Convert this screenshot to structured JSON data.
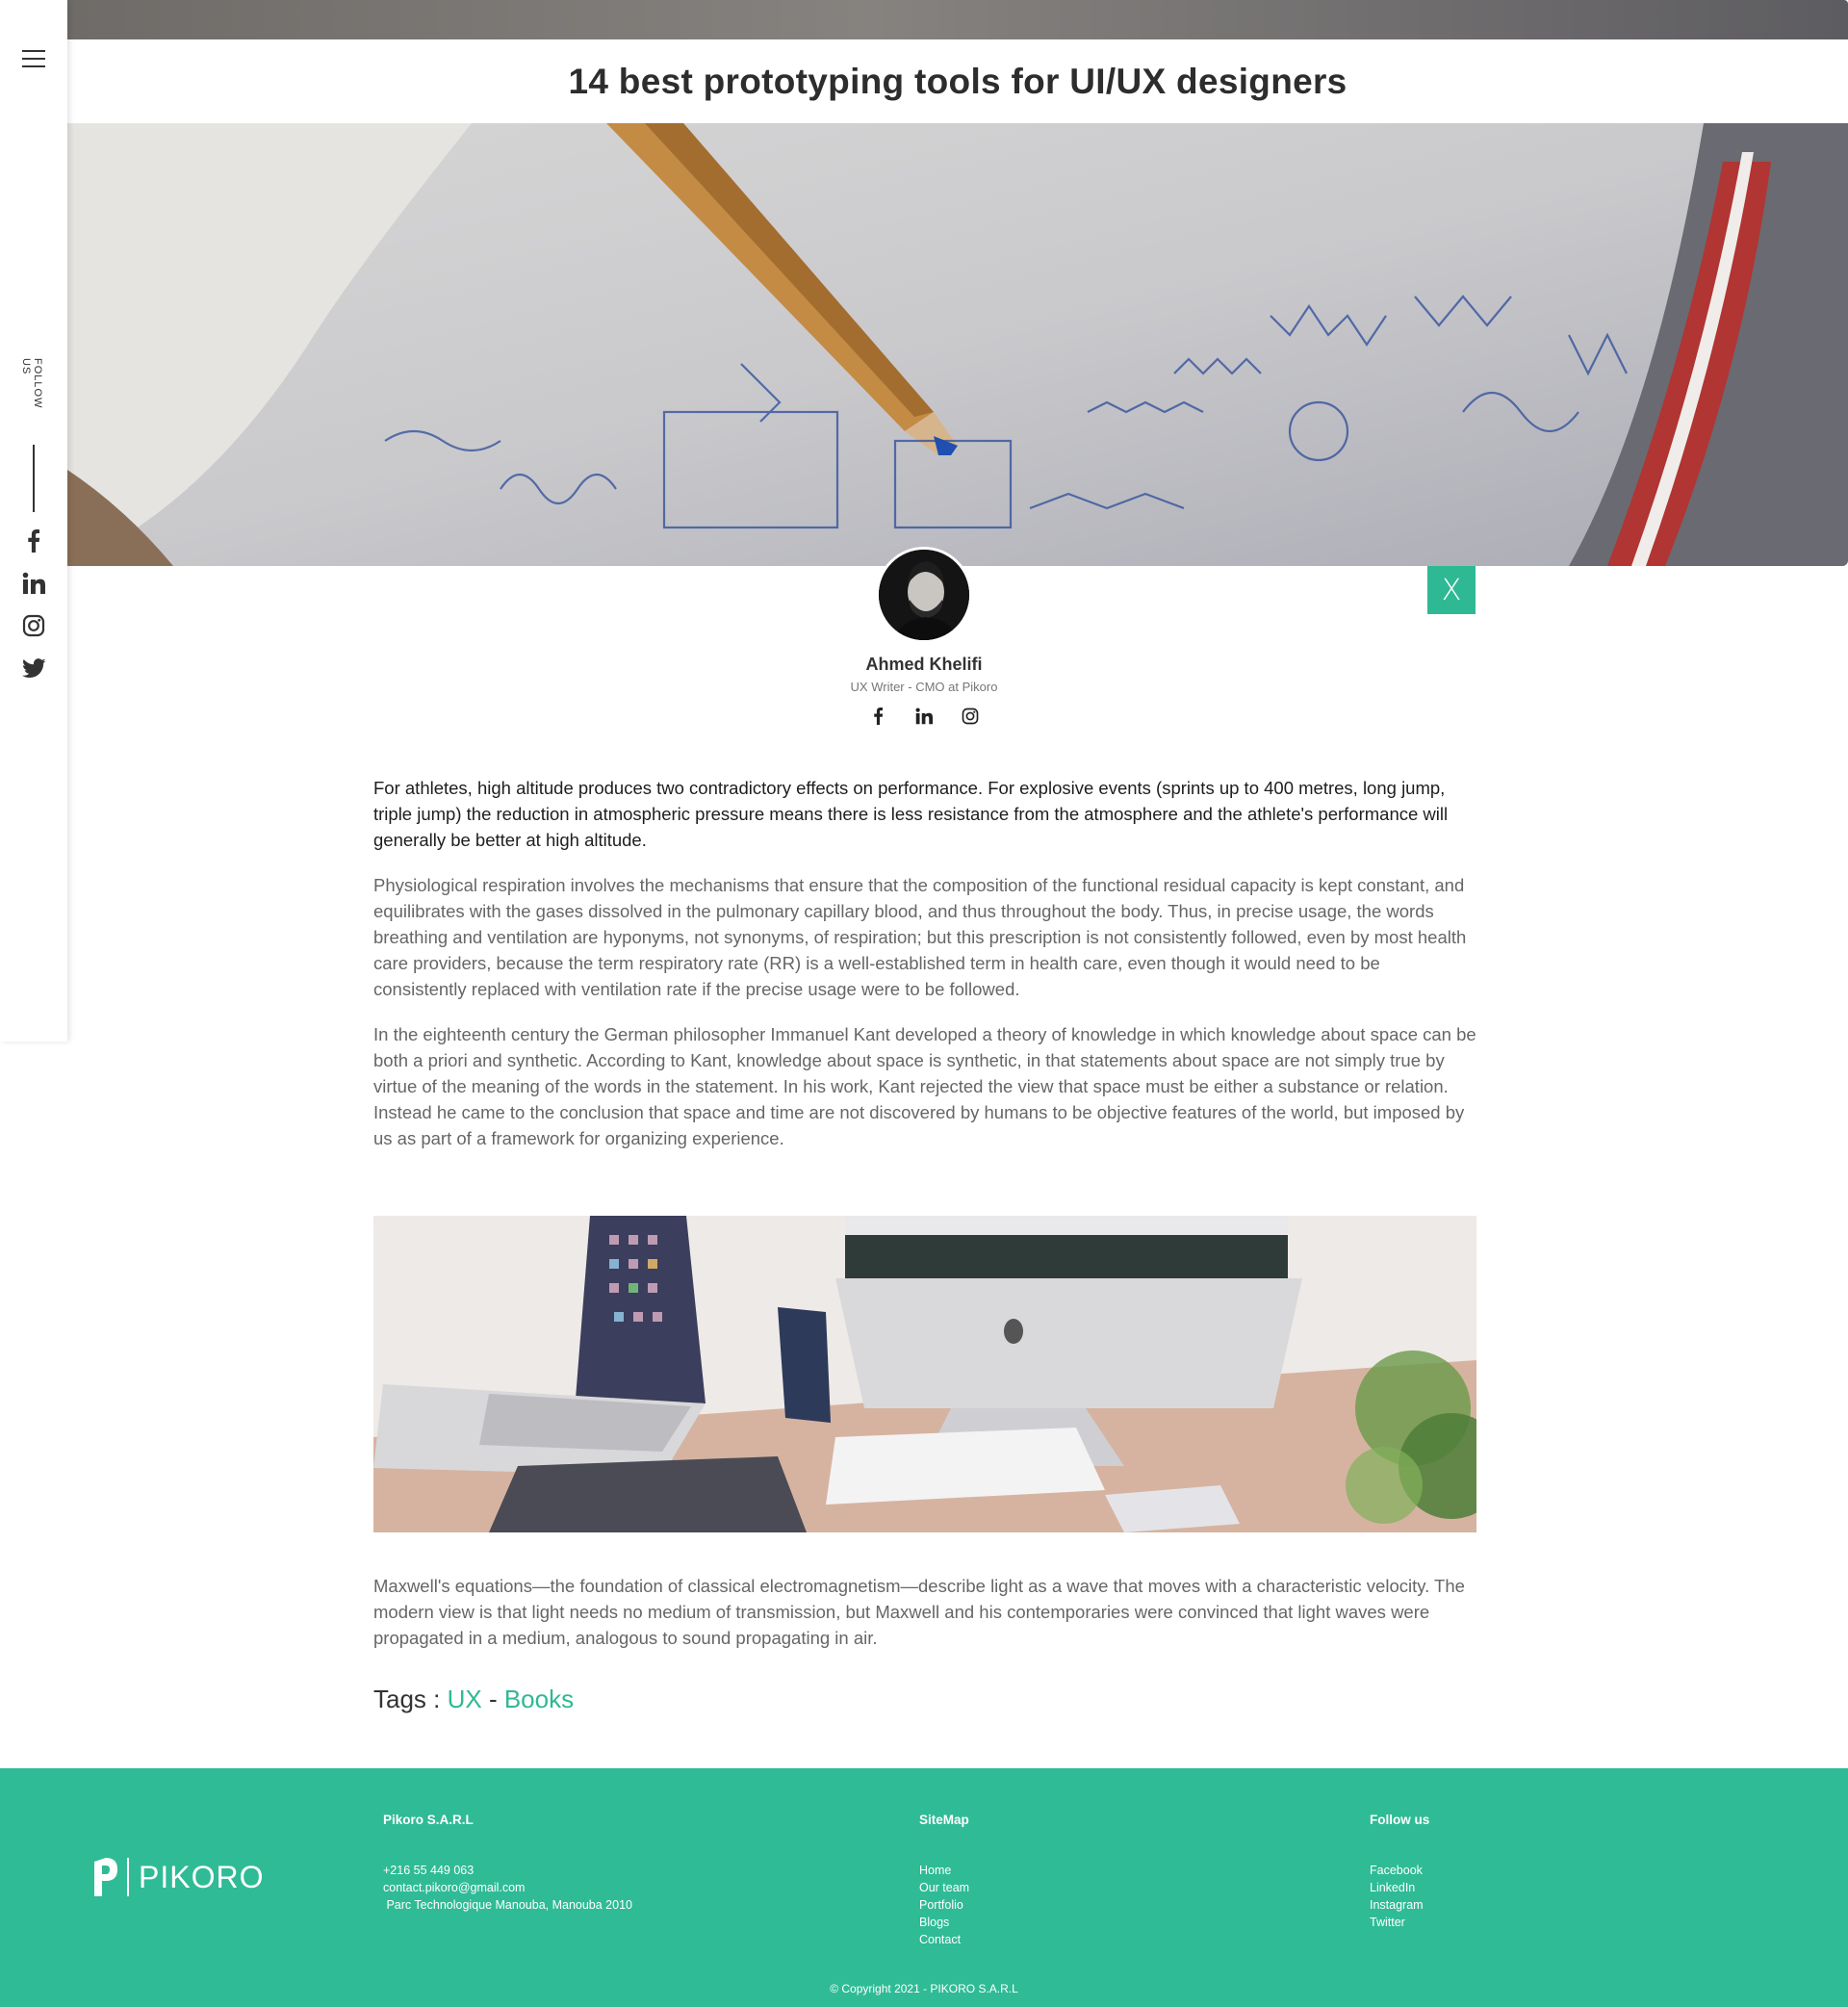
{
  "article": {
    "title": "14 best prototyping tools for UI/UX designers",
    "lead": "For athletes, high altitude produces two contradictory effects on performance. For explosive events (sprints up to 400 metres, long jump, triple jump) the reduction in atmospheric pressure means there is less resistance from the atmosphere and the athlete's performance will generally be better at high altitude.",
    "paragraphs": [
      "Physiological respiration involves the mechanisms that ensure that the composition of the functional residual capacity is kept constant, and equilibrates with the gases dissolved in the pulmonary capillary blood, and thus throughout the body. Thus, in precise usage, the words breathing and ventilation are hyponyms, not synonyms, of respiration; but this prescription is not consistently followed, even by most health care providers, because the term respiratory rate (RR) is a well-established term in health care, even though it would need to be consistently replaced with ventilation rate if the precise usage were to be followed.",
      "In the eighteenth century the German philosopher Immanuel Kant developed a theory of knowledge in which knowledge about space can be both a priori and synthetic. According to Kant, knowledge about space is synthetic, in that statements about space are not simply true by virtue of the meaning of the words in the statement. In his work, Kant rejected the view that space must be either a substance or relation. Instead he came to the conclusion that space and time are not discovered by humans to be objective features of the world, but imposed by us as part of a framework for organizing experience."
    ],
    "last_paragraph": "Maxwell's equations—the foundation of classical electromagnetism—describe light as a wave that moves with a characteristic velocity. The modern view is that light needs no medium of transmission, but Maxwell and his contemporaries were convinced that light waves were propagated in a medium, analogous to sound propagating in air.",
    "tags_label": "Tags :",
    "tags": [
      "UX",
      "Books"
    ],
    "tag_separator": " - "
  },
  "sidebar": {
    "follow_label": "FOLLOW US",
    "icons": [
      "facebook-icon",
      "linkedin-icon",
      "instagram-icon",
      "twitter-icon"
    ]
  },
  "author": {
    "name": "Ahmed Khelifi",
    "role": "UX Writer - CMO at Pikoro",
    "close_label": "X",
    "socials": [
      "facebook-icon",
      "linkedin-icon",
      "instagram-icon"
    ]
  },
  "footer": {
    "logo_text": "PIKORO",
    "company": {
      "heading": "Pikoro S.A.R.L",
      "phone": "+216 55 449 063",
      "email": "contact.pikoro@gmail.com",
      "address": " Parc Technologique Manouba, Manouba 2010"
    },
    "sitemap": {
      "heading": "SiteMap",
      "links": [
        "Home",
        "Our team",
        "Portfolio",
        "Blogs",
        "Contact"
      ]
    },
    "follow": {
      "heading": "Follow us",
      "links": [
        "Facebook",
        "LinkedIn",
        "Instagram",
        "Twitter"
      ]
    },
    "copyright": "© Copyright 2021 - PIKORO S.A.R.L"
  },
  "colors": {
    "accent": "#2eb994",
    "footer_bg": "#2fbb96",
    "text_dark": "#2d2d2d",
    "text_muted": "#666666"
  }
}
